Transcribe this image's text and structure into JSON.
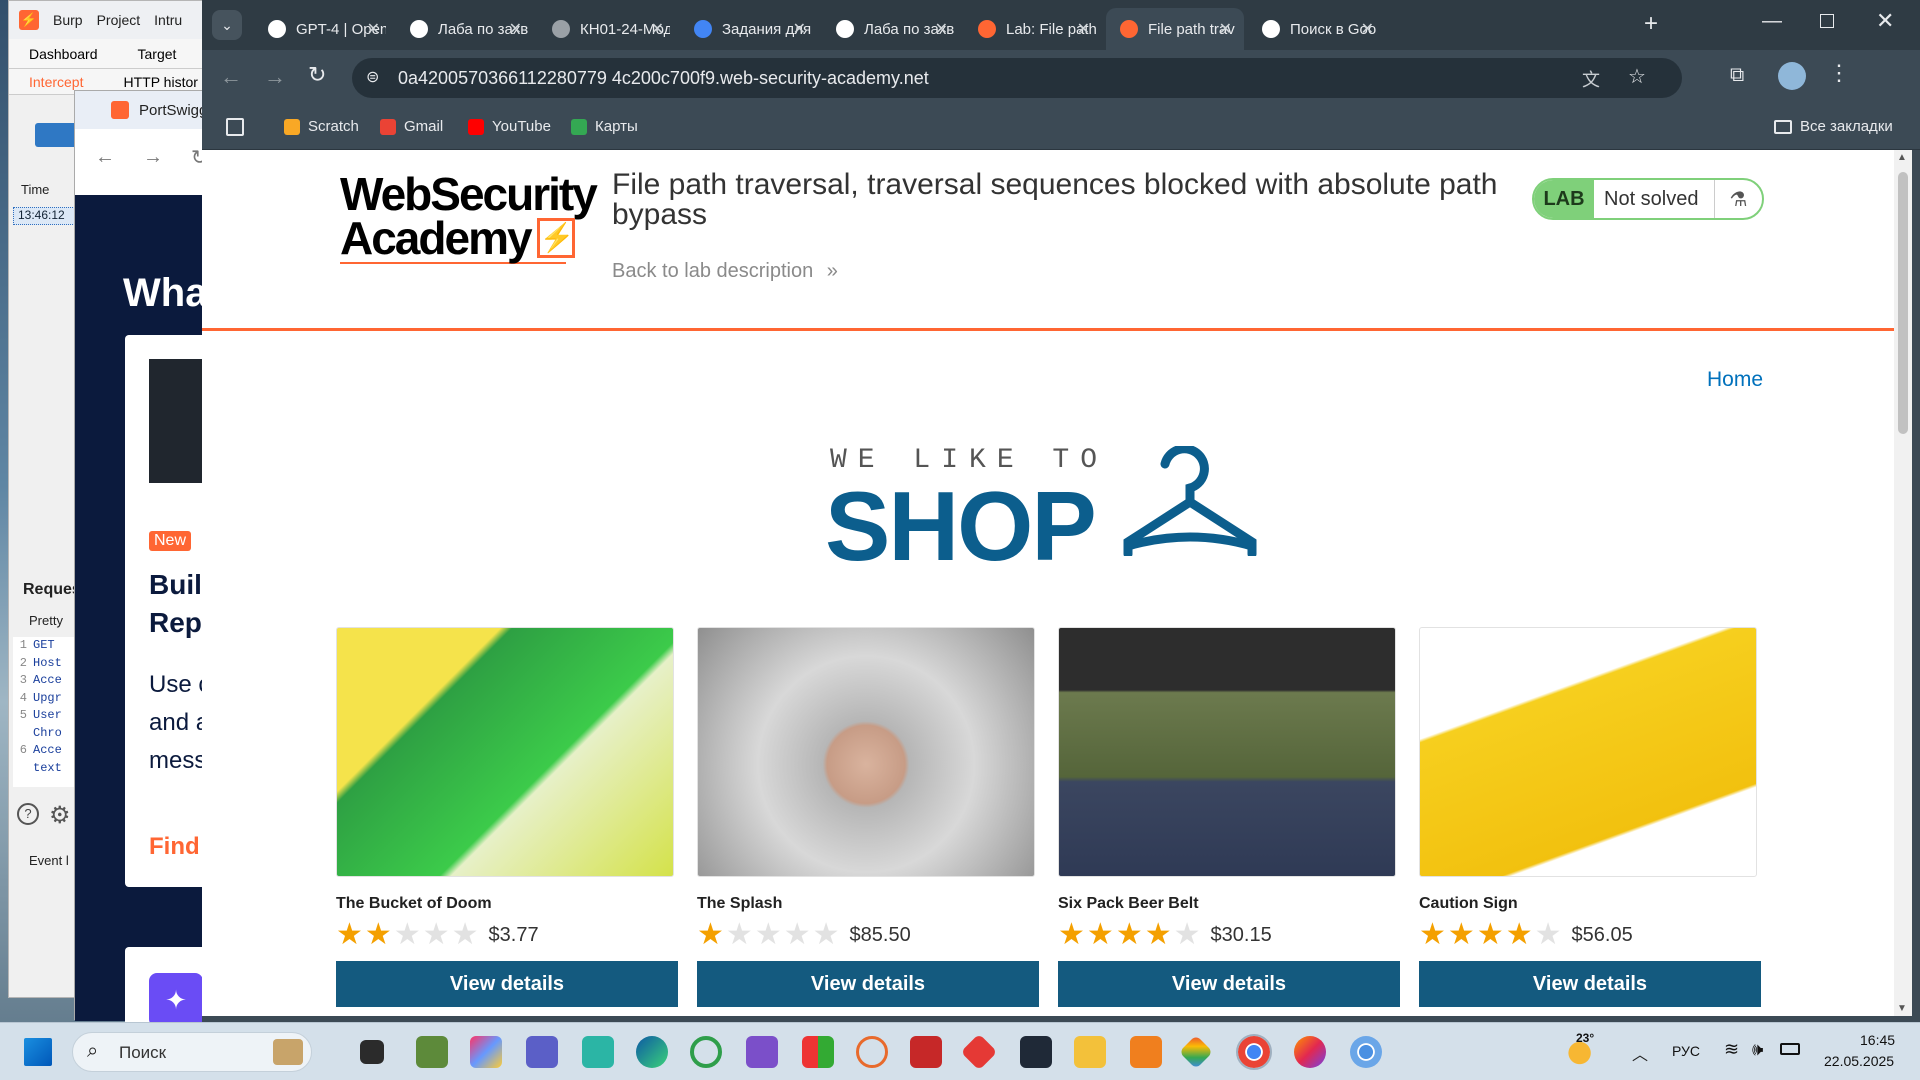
{
  "burp": {
    "menu": [
      "Burp",
      "Project",
      "Intru"
    ],
    "tabs1": [
      "Dashboard",
      "Target"
    ],
    "tabs2": [
      "Intercept",
      "HTTP histor"
    ],
    "col_time": "Time",
    "time_value": "13:46:12",
    "request_label": "Reques",
    "pretty_label": "Pretty",
    "request_lines": [
      {
        "n": "1",
        "t": "GET"
      },
      {
        "n": "2",
        "t": "Host"
      },
      {
        "n": "3",
        "t": "Acce"
      },
      {
        "n": "4",
        "t": "Upgr"
      },
      {
        "n": "5",
        "t": "User"
      },
      {
        "n": "",
        "t": "Chro"
      },
      {
        "n": "6",
        "t": "Acce"
      },
      {
        "n": "",
        "t": "text"
      }
    ],
    "event_label": "Event l"
  },
  "psw": {
    "tab_title": "PortSwigg",
    "heading": "Wha",
    "new_badge": "New",
    "card_title_1": "Buil",
    "card_title_2": "Rep",
    "body_1": "Use c",
    "body_2": "and a",
    "body_3": "mess",
    "find": "Find"
  },
  "browser": {
    "tabs": [
      {
        "title": "GPT-4 | OpenAI",
        "color": "#ffffff"
      },
      {
        "title": "Лаба по захв",
        "color": "#ffffff"
      },
      {
        "title": "КН01-24-Мод",
        "color": "#9aa0a6"
      },
      {
        "title": "Задания для",
        "color": "#4285f4"
      },
      {
        "title": "Лаба по захв",
        "color": "#ffffff"
      },
      {
        "title": "Lab: File path",
        "color": "#ff6633"
      },
      {
        "title": "File path trav",
        "color": "#ff6633"
      },
      {
        "title": "Поиск в Goo",
        "color": "#ffffff"
      }
    ],
    "active_tab_index": 6,
    "url": "0a4200570366112280779 4c200c700f9.web-security-academy.net",
    "bookmarks": [
      {
        "label": "Scratch",
        "color": "#f9a825"
      },
      {
        "label": "Gmail",
        "color": "#ea4335"
      },
      {
        "label": "YouTube",
        "color": "#ff0000"
      },
      {
        "label": "Карты",
        "color": "#34a853"
      }
    ],
    "all_bookmarks": "Все закладки"
  },
  "page": {
    "logo_line1": "WebSecurity",
    "logo_line2": "Academy",
    "lab_title": "File path traversal, traversal sequences blocked with absolute path bypass",
    "back_link": "Back to lab description",
    "lab_badge": "LAB",
    "status": "Not solved",
    "home_link": "Home",
    "tagline_small": "WE LIKE TO",
    "tagline_big": "SHOP",
    "products": [
      {
        "name": "The Bucket of Doom",
        "rating": 2,
        "price": "$3.77",
        "button": "View details"
      },
      {
        "name": "The Splash",
        "rating": 1,
        "price": "$85.50",
        "button": "View details"
      },
      {
        "name": "Six Pack Beer Belt",
        "rating": 4,
        "price": "$30.15",
        "button": "View details"
      },
      {
        "name": "Caution Sign",
        "rating": 4,
        "price": "$56.05",
        "button": "View details"
      }
    ]
  },
  "taskbar": {
    "search_placeholder": "Поиск",
    "temperature": "23°",
    "language": "РУС",
    "time": "16:45",
    "date": "22.05.2025"
  }
}
